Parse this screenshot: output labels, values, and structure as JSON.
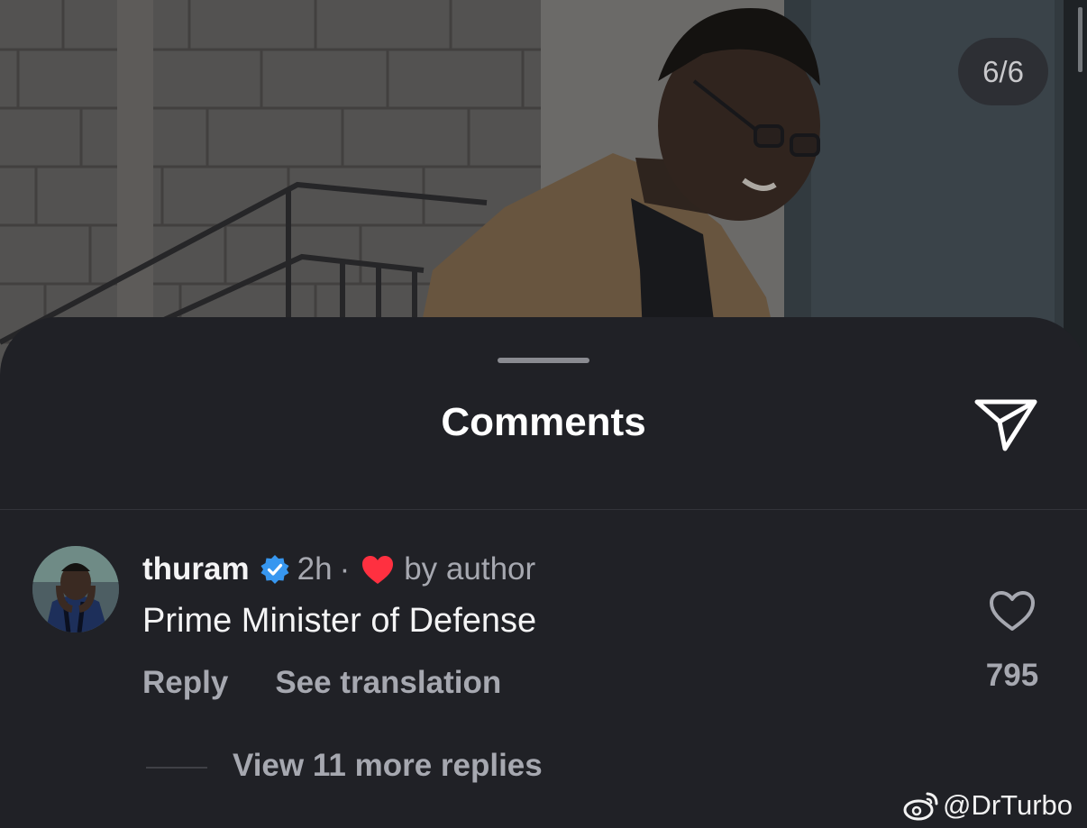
{
  "viewer": {
    "counter": "6/6"
  },
  "sheet": {
    "title": "Comments",
    "share_icon": "paper-plane-icon"
  },
  "comment": {
    "username": "thuram",
    "verified_icon": "verified-badge-icon",
    "time": "2h",
    "separator": "·",
    "liked_icon": "heart-filled-icon",
    "liked_label": "by author",
    "text": "Prime Minister of Defense",
    "reply_label": "Reply",
    "translate_label": "See translation",
    "like_icon": "heart-outline-icon",
    "like_count": "795",
    "view_replies": "View 11 more replies"
  },
  "watermark": {
    "icon": "weibo-icon",
    "text": "@DrTurbo"
  },
  "colors": {
    "sheet_bg": "#202126",
    "text_primary": "#f4f4f5",
    "text_secondary": "#a6a8b0",
    "verified_blue": "#3797f0",
    "heart_red": "#ff3040"
  }
}
